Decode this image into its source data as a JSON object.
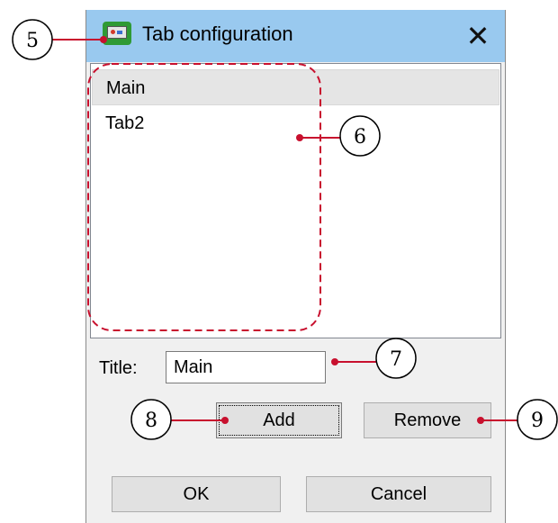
{
  "window": {
    "title": "Tab configuration",
    "close_glyph": "✕",
    "icon": "app-monitor-icon"
  },
  "tab_list": {
    "items": [
      {
        "label": "Main",
        "selected": true
      },
      {
        "label": "Tab2",
        "selected": false
      }
    ]
  },
  "form": {
    "title_label": "Title:",
    "title_value": "Main"
  },
  "buttons": {
    "add": "Add",
    "remove": "Remove",
    "ok": "OK",
    "cancel": "Cancel"
  },
  "callouts": [
    "5",
    "6",
    "7",
    "8",
    "9"
  ],
  "colors": {
    "titlebar": "#99c9ef",
    "callout_line": "#c8102e"
  }
}
